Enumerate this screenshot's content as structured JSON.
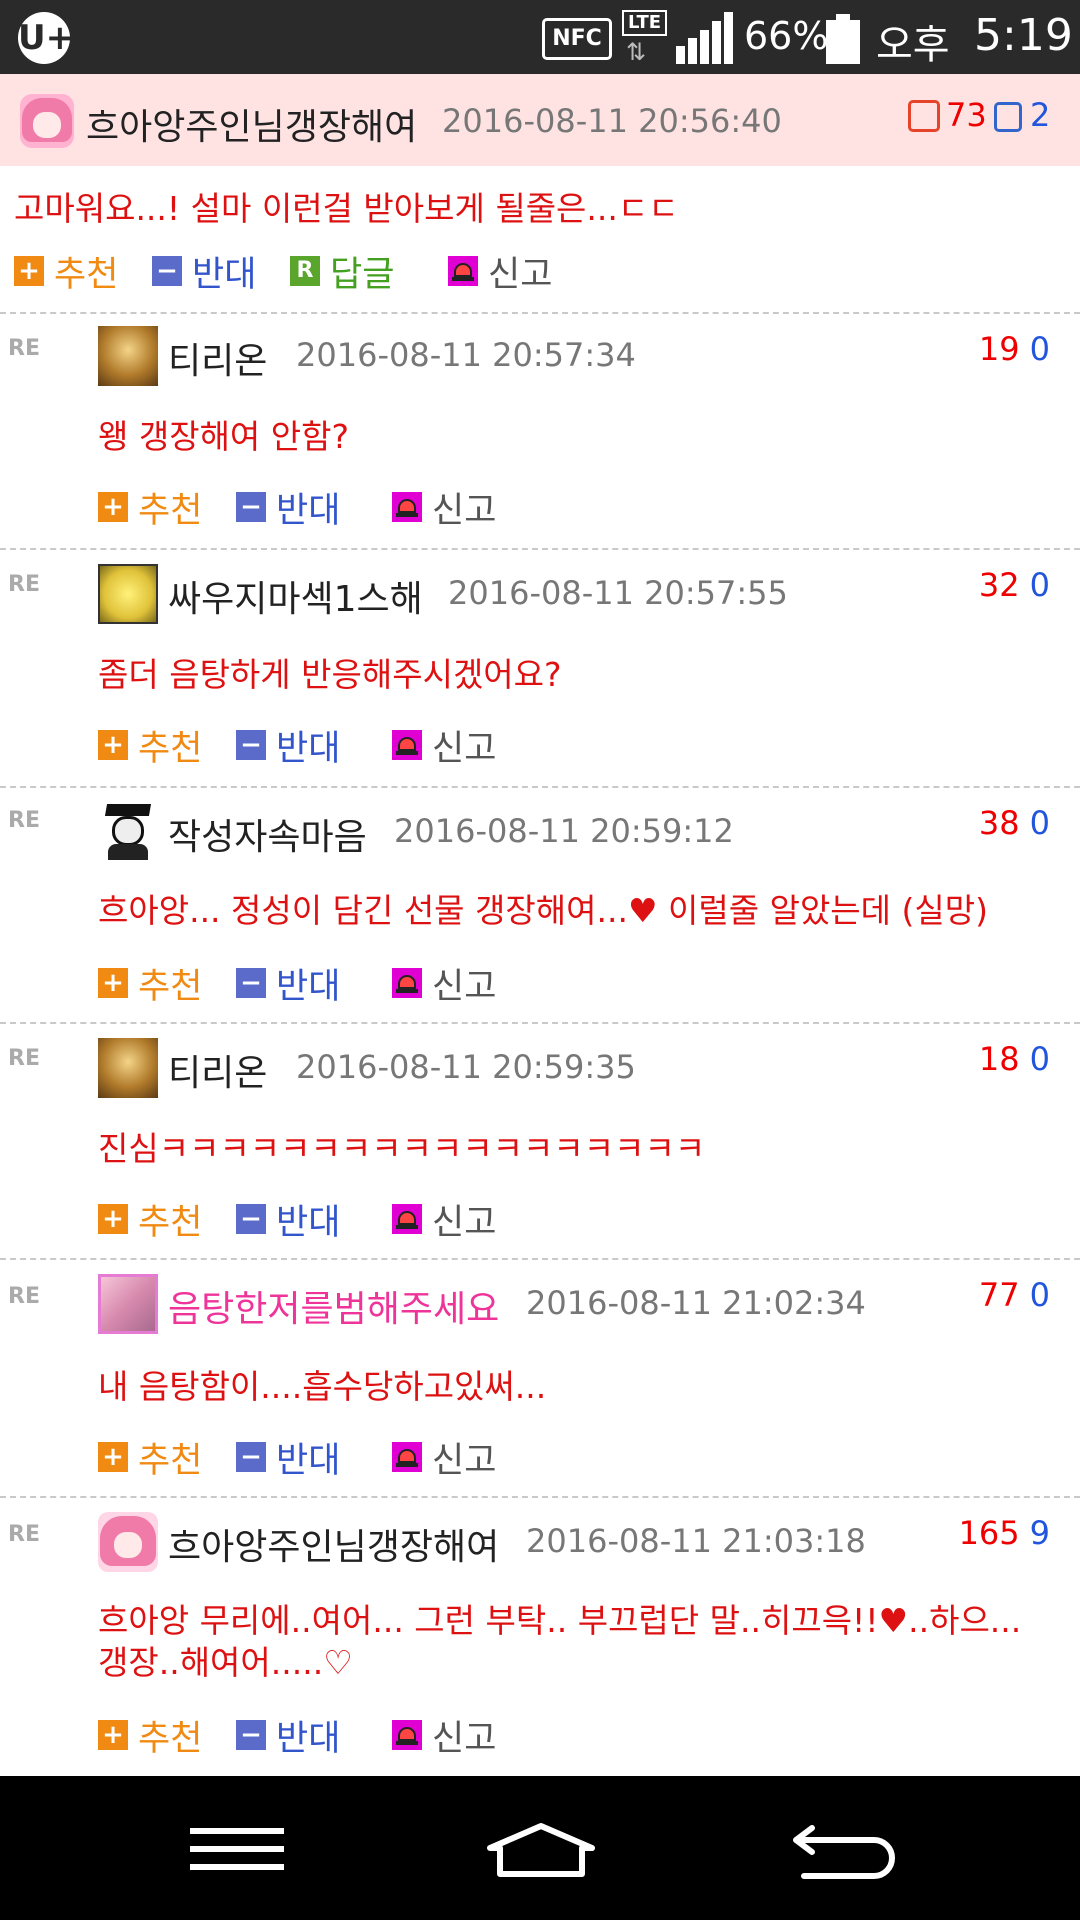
{
  "status_bar": {
    "carrier_icon": "U+",
    "nfc": "NFC",
    "network": "LTE",
    "battery_pct": "66%",
    "ampm": "오후",
    "time": "5:19"
  },
  "post": {
    "author": "흐아앙주인님갱장해여",
    "date": "2016-08-11 20:56:40",
    "upvotes": "73",
    "downvotes": "2",
    "body": "고마워요...! 설마 이런걸 받아보게 될줄은...ㄷㄷ"
  },
  "actions": {
    "recommend": "추천",
    "oppose": "반대",
    "reply": "답글",
    "report": "신고",
    "re_mark": "RE",
    "reply_icon_text": "R"
  },
  "comments": [
    {
      "author": "티리온",
      "date": "2016-08-11 20:57:34",
      "up": "19",
      "down": "0",
      "text": "왱 갱장해여 안함?"
    },
    {
      "author": "싸우지마섹1스해",
      "date": "2016-08-11 20:57:55",
      "up": "32",
      "down": "0",
      "text": "좀더 음탕하게 반응해주시겠어요?"
    },
    {
      "author": "작성자속마음",
      "date": "2016-08-11 20:59:12",
      "up": "38",
      "down": "0",
      "text": "흐아앙... 정성이 담긴 선물 갱장해여...♥ 이럴줄 알았는데 (실망)"
    },
    {
      "author": "티리온",
      "date": "2016-08-11 20:59:35",
      "up": "18",
      "down": "0",
      "text": "진심ㅋㅋㅋㅋㅋㅋㅋㅋㅋㅋㅋㅋㅋㅋㅋㅋㅋㅋ"
    },
    {
      "author": "음탕한저를범해주세요",
      "date": "2016-08-11 21:02:34",
      "up": "77",
      "down": "0",
      "text": "내 음탕함이....흡수당하고있써..."
    },
    {
      "author": "흐아앙주인님갱장해여",
      "date": "2016-08-11 21:03:18",
      "up": "165",
      "down": "9",
      "text": "흐아앙 무리에..여어... 그런 부탁.. 부끄럽단 말..히끄윽!!♥..하으...",
      "text2": "갱장..해여어.....♡"
    }
  ]
}
